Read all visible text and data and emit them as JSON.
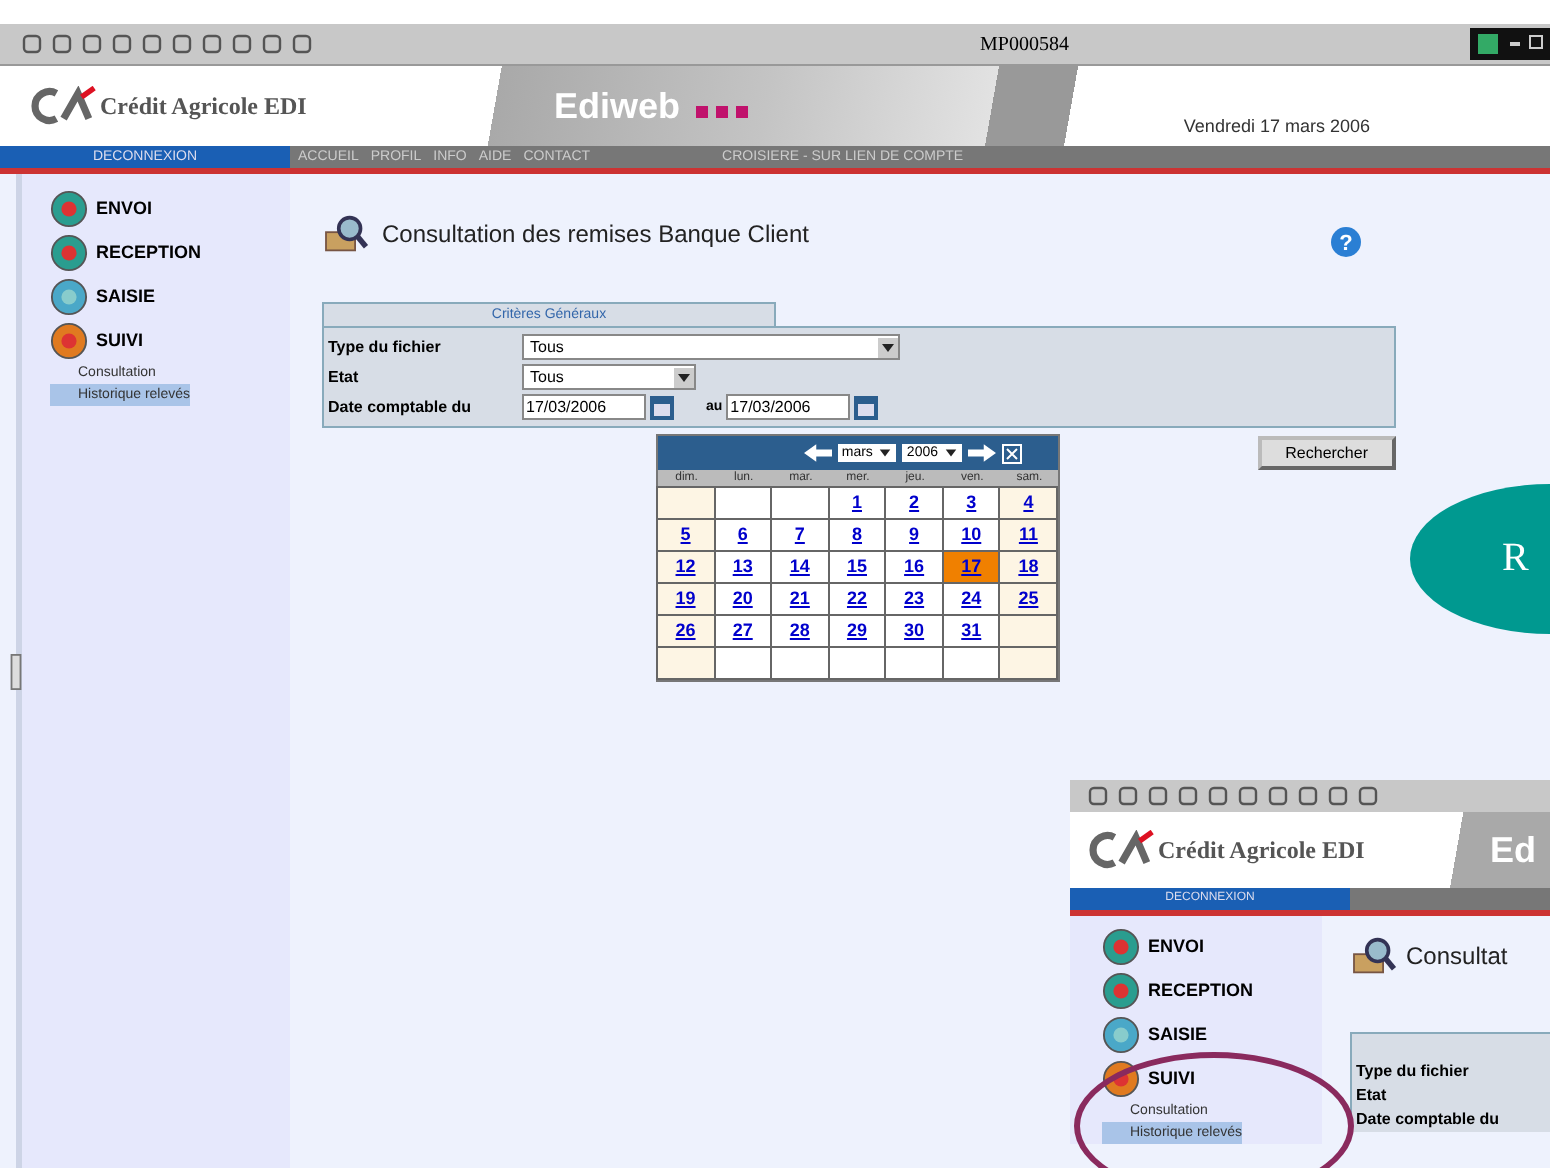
{
  "browser_toolbar": {
    "title": "MP000584"
  },
  "header": {
    "logo_text": "Crédit Agricole EDI",
    "banner": "Ediweb",
    "date": "Vendredi 17 mars 2006"
  },
  "nav": {
    "logout": "DECONNEXION",
    "links": [
      "ACCUEIL",
      "PROFIL",
      "INFO",
      "AIDE",
      "CONTACT"
    ],
    "notice": "CROISIERE - SUR LIEN DE COMPTE"
  },
  "sidebar": {
    "items": [
      {
        "label": "ENVOI",
        "kind": "send"
      },
      {
        "label": "RECEPTION",
        "kind": "receive"
      },
      {
        "label": "SAISIE",
        "kind": "entry"
      },
      {
        "label": "SUIVI",
        "kind": "track",
        "children": [
          {
            "label": "Consultation",
            "selected": false
          },
          {
            "label": "Historique relevés",
            "selected": true
          }
        ]
      }
    ]
  },
  "page": {
    "title": "Consultation des remises Banque Client",
    "help": "?"
  },
  "form": {
    "tab": "Critères Généraux",
    "fields": [
      {
        "label": "Type du fichier",
        "value": "Tous",
        "kind": "wide-select"
      },
      {
        "label": "Etat",
        "value": "Tous",
        "kind": "select"
      }
    ],
    "date": {
      "label": "Date comptable du",
      "from": "17/03/2006",
      "to_label": "au",
      "to": "17/03/2006"
    },
    "button": "Rechercher"
  },
  "calendar": {
    "month": "mars",
    "year": "2006",
    "weekdays": [
      "dim.",
      "lun.",
      "mar.",
      "mer.",
      "jeu.",
      "ven.",
      "sam."
    ],
    "weeks": [
      [
        {
          "kind": "blank"
        },
        {
          "kind": "blank"
        },
        {
          "kind": "blank"
        },
        {
          "day": "1",
          "selected": false
        },
        {
          "day": "2",
          "selected": false
        },
        {
          "day": "3",
          "selected": false
        },
        {
          "day": "4",
          "selected": false
        }
      ],
      [
        {
          "day": "5",
          "selected": false
        },
        {
          "day": "6",
          "selected": false
        },
        {
          "day": "7",
          "selected": false
        },
        {
          "day": "8",
          "selected": false
        },
        {
          "day": "9",
          "selected": false
        },
        {
          "day": "10",
          "selected": false
        },
        {
          "day": "11",
          "selected": false
        }
      ],
      [
        {
          "day": "12",
          "selected": false
        },
        {
          "day": "13",
          "selected": false
        },
        {
          "day": "14",
          "selected": false
        },
        {
          "day": "15",
          "selected": false
        },
        {
          "day": "16",
          "selected": false
        },
        {
          "day": "17",
          "selected": true
        },
        {
          "day": "18",
          "selected": false
        }
      ],
      [
        {
          "day": "19",
          "selected": false
        },
        {
          "day": "20",
          "selected": false
        },
        {
          "day": "21",
          "selected": false
        },
        {
          "day": "22",
          "selected": false
        },
        {
          "day": "23",
          "selected": false
        },
        {
          "day": "24",
          "selected": false
        },
        {
          "day": "25",
          "selected": false
        }
      ],
      [
        {
          "day": "26",
          "selected": false
        },
        {
          "day": "27",
          "selected": false
        },
        {
          "day": "28",
          "selected": false
        },
        {
          "day": "29",
          "selected": false
        },
        {
          "day": "30",
          "selected": false
        },
        {
          "day": "31",
          "selected": false
        },
        {
          "kind": "blank"
        }
      ],
      [
        {
          "kind": "blank"
        },
        {
          "kind": "blank"
        },
        {
          "kind": "blank"
        },
        {
          "kind": "blank"
        },
        {
          "kind": "blank"
        },
        {
          "kind": "blank"
        },
        {
          "kind": "blank"
        }
      ]
    ]
  },
  "callout": {
    "text": "R"
  },
  "inset": {
    "logo_text": "Crédit Agricole EDI",
    "banner": "Ed",
    "nav_logout": "DECONNEXION",
    "sidebar_items": [
      {
        "label": "ENVOI",
        "kind": "send"
      },
      {
        "label": "RECEPTION",
        "kind": "receive"
      },
      {
        "label": "SAISIE",
        "kind": "entry"
      },
      {
        "label": "SUIVI",
        "kind": "track"
      }
    ],
    "sub_items": [
      {
        "label": "Consultation",
        "selected": false
      },
      {
        "label": "Historique relevés",
        "selected": true
      }
    ],
    "title": "Consultat",
    "form_labels": [
      "Type du fichier",
      "Etat",
      "Date comptable du"
    ]
  }
}
